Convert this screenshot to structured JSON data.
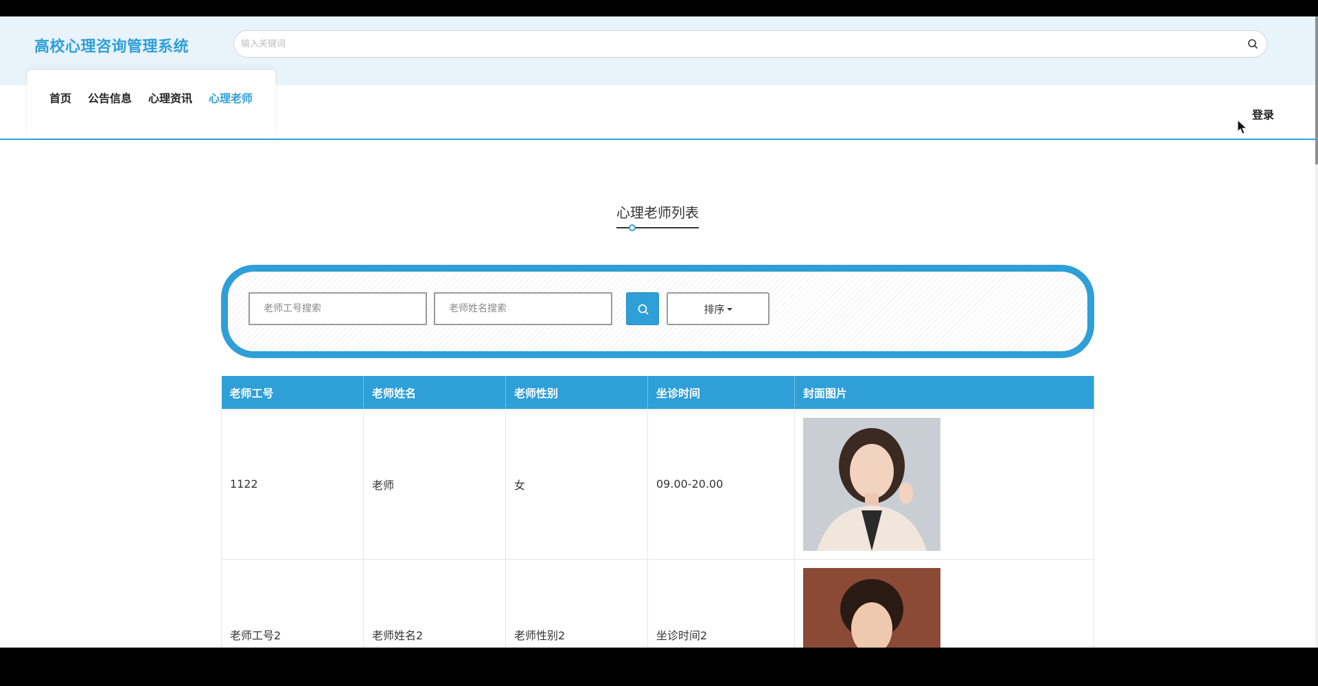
{
  "header": {
    "brand": "高校心理咨询管理系统",
    "search_placeholder": "输入关键词"
  },
  "nav": {
    "items": [
      {
        "label": "首页"
      },
      {
        "label": "公告信息"
      },
      {
        "label": "心理资讯"
      },
      {
        "label": "心理老师"
      }
    ],
    "active_label": "心理老师",
    "login_label": "登录"
  },
  "page": {
    "title": "心理老师列表"
  },
  "filter": {
    "teacher_id_placeholder": "老师工号搜索",
    "teacher_name_placeholder": "老师姓名搜索",
    "sort_label": "排序"
  },
  "table": {
    "headers": [
      "老师工号",
      "老师姓名",
      "老师性别",
      "坐诊时间",
      "封面图片"
    ],
    "rows": [
      {
        "id": "1122",
        "name": "老师",
        "gender": "女",
        "time": "09.00-20.00",
        "photo_desc": "female teacher portrait"
      },
      {
        "id": "老师工号2",
        "name": "老师姓名2",
        "gender": "老师性别2",
        "time": "坐诊时间2",
        "photo_desc": "male teacher portrait"
      }
    ]
  },
  "colors": {
    "accent": "#2f9fd8",
    "header_band": "#e8f3fa"
  }
}
